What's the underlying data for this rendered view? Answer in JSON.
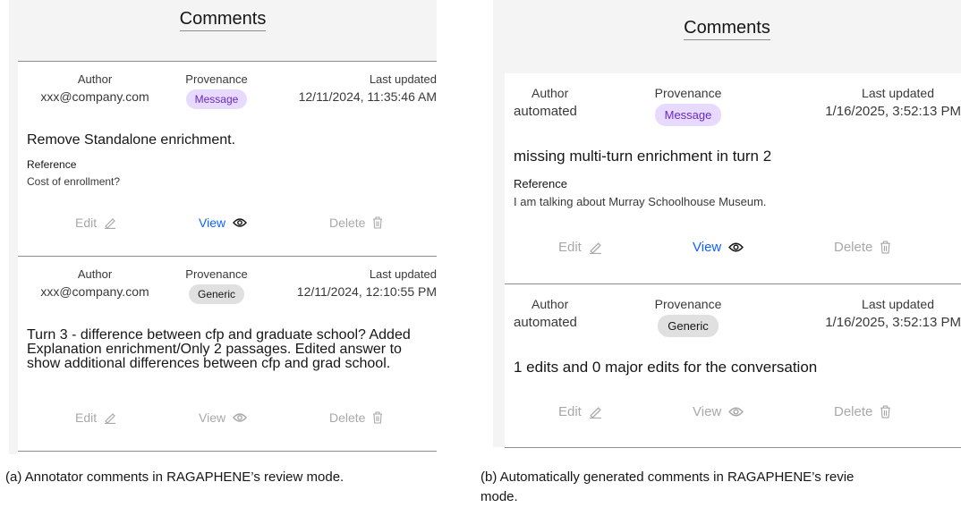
{
  "panels": [
    {
      "title": "Comments",
      "caption": "(a) Annotator comments in RAGAPHENE’s review mode.",
      "comments": [
        {
          "author_label": "Author",
          "author": "xxx@company.com",
          "provenance_label": "Provenance",
          "provenance": "Message",
          "updated_label": "Last updated",
          "updated": "12/11/2024, 11:35:46 AM",
          "text": "Remove Standalone enrichment.",
          "reference_label": "Reference",
          "reference": "Cost of enrollment?",
          "edit_label": "Edit",
          "view_label": "View",
          "delete_label": "Delete"
        },
        {
          "author_label": "Author",
          "author": "xxx@company.com",
          "provenance_label": "Provenance",
          "provenance": "Generic",
          "updated_label": "Last updated",
          "updated": "12/11/2024, 12:10:55 PM",
          "text": "Turn 3 - difference between cfp and graduate school? Added Explanation enrichment/Only 2 passages. Edited answer to show additional differences between cfp and grad school.",
          "edit_label": "Edit",
          "view_label": "View",
          "delete_label": "Delete"
        }
      ]
    },
    {
      "title": "Comments",
      "caption_line1": "(b) Automatically generated comments in RAGAPHENE’s revie",
      "caption_line2": "mode.",
      "comments": [
        {
          "author_label": "Author",
          "author": "automated",
          "provenance_label": "Provenance",
          "provenance": "Message",
          "updated_label": "Last updated",
          "updated": "1/16/2025, 3:52:13 PM",
          "text": "missing multi-turn enrichment in turn 2",
          "reference_label": "Reference",
          "reference": "I am talking about Murray Schoolhouse Museum.",
          "edit_label": "Edit",
          "view_label": "View",
          "delete_label": "Delete"
        },
        {
          "author_label": "Author",
          "author": "automated",
          "provenance_label": "Provenance",
          "provenance": "Generic",
          "updated_label": "Last updated",
          "updated": "1/16/2025, 3:52:13 PM",
          "text": "1 edits and 0 major edits for the conversation",
          "edit_label": "Edit",
          "view_label": "View",
          "delete_label": "Delete"
        }
      ]
    }
  ],
  "colors": {
    "message_tag_bg": "#e8daff",
    "message_tag_text": "#6929c4",
    "generic_tag_bg": "#e0e0e0",
    "link": "#0f62fe",
    "disabled": "#a8a8a8"
  },
  "icons": [
    "pencil-icon",
    "eye-icon",
    "trash-icon"
  ]
}
